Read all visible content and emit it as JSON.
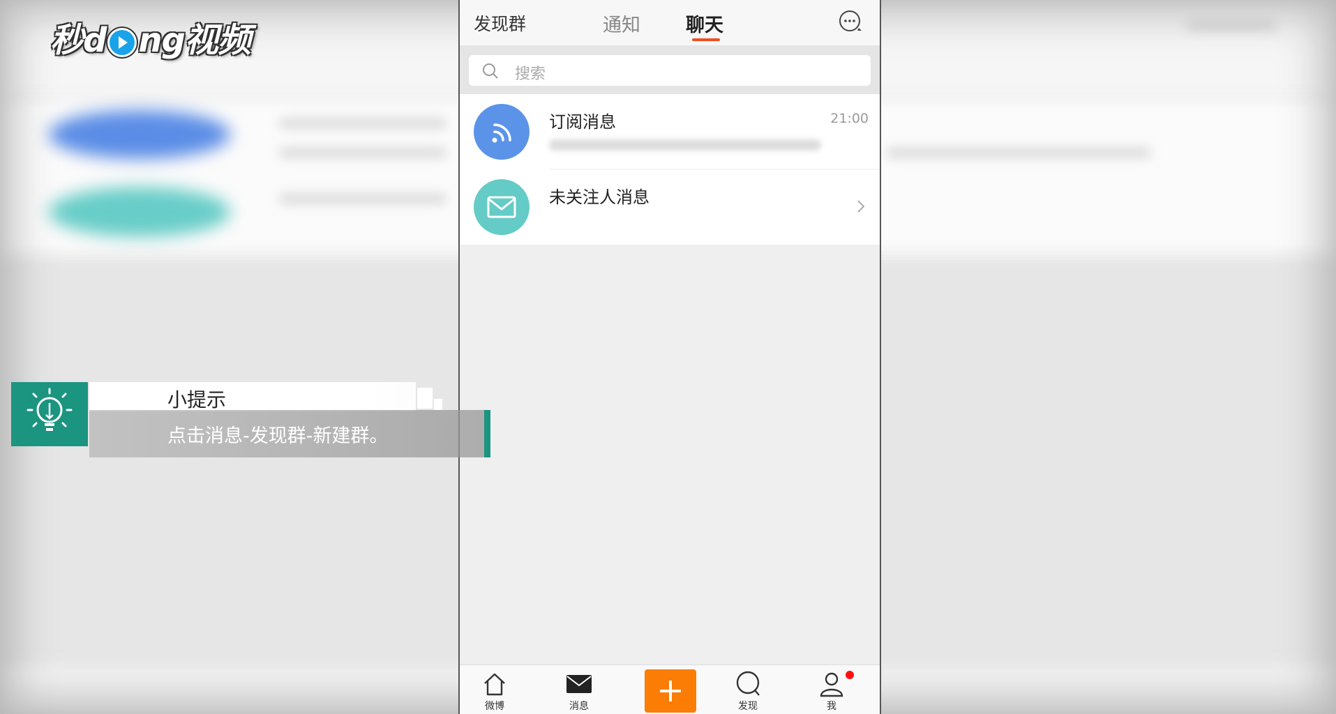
{
  "watermark": {
    "text_left": "秒d",
    "text_right": "ng视频"
  },
  "header": {
    "left_label": "发现群",
    "tabs": [
      "通知",
      "聊天"
    ],
    "active_tab": "聊天"
  },
  "search": {
    "placeholder": "搜索"
  },
  "conversations": [
    {
      "title": "订阅消息",
      "time": "21:00",
      "icon": "rss-icon",
      "color": "#5b93e8"
    },
    {
      "title": "未关注人消息",
      "time": "",
      "icon": "mail-icon",
      "color": "#64cbc6"
    }
  ],
  "tabbar": {
    "items": [
      "微博",
      "消息",
      "发现",
      "我"
    ]
  },
  "tip": {
    "title": "小提示",
    "text": "点击消息-发现群-新建群。"
  },
  "colors": {
    "accent": "#f04e23",
    "plus": "#fb7d05",
    "tip": "#1b9480"
  }
}
